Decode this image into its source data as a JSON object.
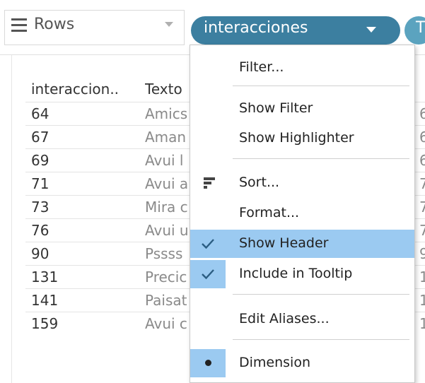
{
  "shelf": {
    "rows_label": "Rows",
    "pill_label": "interacciones",
    "next_pill_label": "T"
  },
  "table": {
    "headers": [
      "interaccion..",
      "Texto"
    ],
    "rows": [
      {
        "id": "64",
        "text": "Amics",
        "far": "6"
      },
      {
        "id": "67",
        "text": "Aman",
        "far": "6"
      },
      {
        "id": "69",
        "text": "Avui l",
        "far": "6"
      },
      {
        "id": "71",
        "text": "Avui a",
        "far": "7"
      },
      {
        "id": "73",
        "text": "Mira c",
        "far": "7"
      },
      {
        "id": "76",
        "text": "Avui u",
        "far": "7"
      },
      {
        "id": "90",
        "text": "Pssss",
        "far": "9"
      },
      {
        "id": "131",
        "text": "Precic",
        "far": "1"
      },
      {
        "id": "141",
        "text": "Paisat",
        "far": "1"
      },
      {
        "id": "159",
        "text": "Avui c",
        "far": "1"
      }
    ]
  },
  "menu": {
    "items": {
      "filter": "Filter...",
      "show_filter": "Show Filter",
      "show_highlighter": "Show Highlighter",
      "sort": "Sort...",
      "format": "Format...",
      "show_header": "Show Header",
      "include_tooltip": "Include in Tooltip",
      "edit_aliases": "Edit Aliases...",
      "dimension": "Dimension"
    },
    "checked": [
      "Show Header",
      "Include in Tooltip"
    ],
    "selected_role": "Dimension"
  },
  "colors": {
    "pill": "#3c7fa0",
    "highlight": "#9bcaf1",
    "icon": "#444444"
  },
  "icons": [
    "rows-icon",
    "chevron-down-icon",
    "sort-icon",
    "check-icon",
    "bullet-icon"
  ]
}
